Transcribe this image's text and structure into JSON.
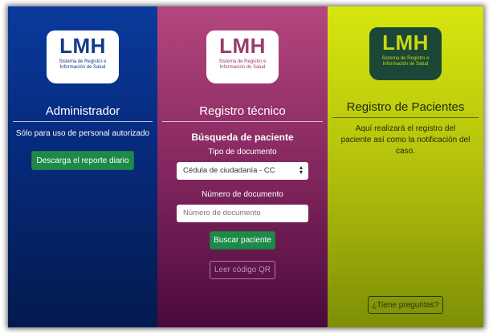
{
  "brand": {
    "logo_text": "LMH",
    "logo_subtitle_line1": "Sistema de Registro e",
    "logo_subtitle_line2": "Información de Salud"
  },
  "admin": {
    "title": "Administrador",
    "note": "Sólo para uso de personal autorizado",
    "download_button": "Descarga el reporte diario"
  },
  "tech": {
    "title": "Registro técnico",
    "search_title": "Búsqueda de paciente",
    "doc_type_label": "Tipo de documento",
    "doc_type_selected": "Cédula de ciudadanía - CC",
    "doc_number_label": "Número de documento",
    "doc_number_placeholder": "Número de documento",
    "search_button": "Buscar paciente",
    "qr_button": "Leer código QR"
  },
  "patients": {
    "title": "Registro de Pacientes",
    "note": "Aquí realizará el registro del paciente así como la notificación del caso.",
    "help_button": "¿Tiene preguntas?"
  },
  "colors": {
    "admin_bg": "#062a7c",
    "tech_bg": "#8a2a63",
    "patients_bg": "#b3c10c",
    "button_green": "#1e8a4a"
  }
}
